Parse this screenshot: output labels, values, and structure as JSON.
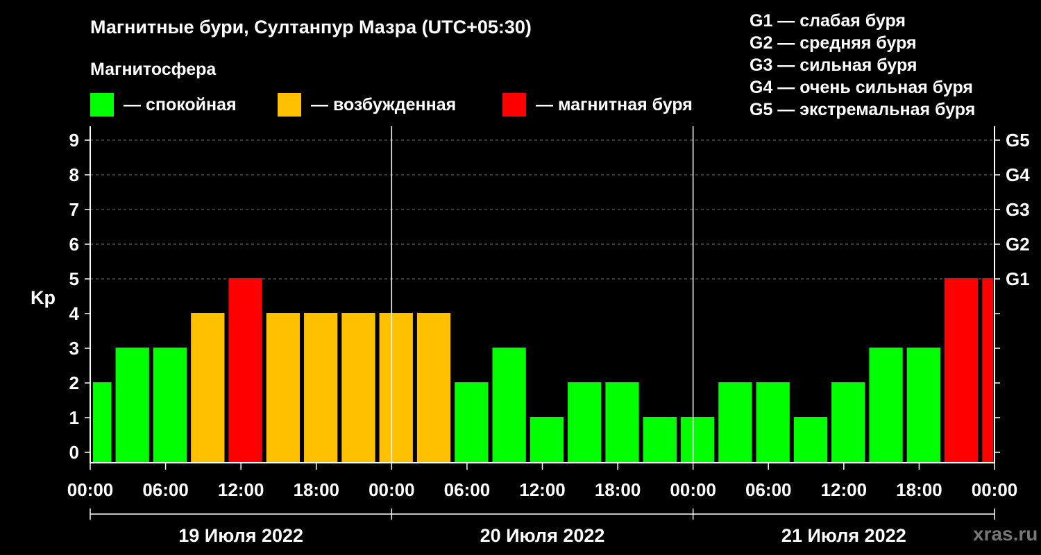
{
  "chart_data": {
    "type": "bar",
    "title": "Магнитные бури, Султанпур Мазра (UTC+05:30)",
    "subtitle": "Магнитосфера",
    "ylabel": "Kp",
    "ylim": [
      0,
      9
    ],
    "yticks": [
      "0",
      "1",
      "2",
      "3",
      "4",
      "5",
      "6",
      "7",
      "8",
      "9"
    ],
    "right_ticks": [
      {
        "value": 5,
        "label": "G1"
      },
      {
        "value": 6,
        "label": "G2"
      },
      {
        "value": 7,
        "label": "G3"
      },
      {
        "value": 8,
        "label": "G4"
      },
      {
        "value": 9,
        "label": "G5"
      }
    ],
    "x_range_hours": [
      0,
      72
    ],
    "x_ticks": [
      "00:00",
      "06:00",
      "12:00",
      "18:00",
      "00:00",
      "06:00",
      "12:00",
      "18:00",
      "00:00",
      "06:00",
      "12:00",
      "18:00",
      "00:00"
    ],
    "day_labels": [
      "19 Июля 2022",
      "20 Июля 2022",
      "21 Июля 2022"
    ],
    "legend": [
      {
        "label": "— спокойная",
        "color": "#00ff00"
      },
      {
        "label": "— возбужденная",
        "color": "#ffc000"
      },
      {
        "label": "— магнитная буря",
        "color": "#ff0000"
      }
    ],
    "g_legend": [
      "G1 — слабая буря",
      "G2 — средняя буря",
      "G3 — сильная буря",
      "G4 — очень сильная буря",
      "G5 — экстремальная буря"
    ],
    "bars": [
      {
        "start": 0,
        "end": 1.8,
        "value": 2,
        "level": "quiet"
      },
      {
        "start": 1.8,
        "end": 4.8,
        "value": 3,
        "level": "quiet"
      },
      {
        "start": 4.8,
        "end": 7.8,
        "value": 3,
        "level": "quiet"
      },
      {
        "start": 7.8,
        "end": 10.8,
        "value": 4,
        "level": "active"
      },
      {
        "start": 10.8,
        "end": 13.8,
        "value": 5,
        "level": "storm"
      },
      {
        "start": 13.8,
        "end": 16.8,
        "value": 4,
        "level": "active"
      },
      {
        "start": 16.8,
        "end": 19.8,
        "value": 4,
        "level": "active"
      },
      {
        "start": 19.8,
        "end": 22.8,
        "value": 4,
        "level": "active"
      },
      {
        "start": 22.8,
        "end": 25.8,
        "value": 4,
        "level": "active"
      },
      {
        "start": 25.8,
        "end": 28.8,
        "value": 4,
        "level": "active"
      },
      {
        "start": 28.8,
        "end": 31.8,
        "value": 2,
        "level": "quiet"
      },
      {
        "start": 31.8,
        "end": 34.8,
        "value": 3,
        "level": "quiet"
      },
      {
        "start": 34.8,
        "end": 37.8,
        "value": 1,
        "level": "quiet"
      },
      {
        "start": 37.8,
        "end": 40.8,
        "value": 2,
        "level": "quiet"
      },
      {
        "start": 40.8,
        "end": 43.8,
        "value": 2,
        "level": "quiet"
      },
      {
        "start": 43.8,
        "end": 46.8,
        "value": 1,
        "level": "quiet"
      },
      {
        "start": 46.8,
        "end": 49.8,
        "value": 1,
        "level": "quiet"
      },
      {
        "start": 49.8,
        "end": 52.8,
        "value": 2,
        "level": "quiet"
      },
      {
        "start": 52.8,
        "end": 55.8,
        "value": 2,
        "level": "quiet"
      },
      {
        "start": 55.8,
        "end": 58.8,
        "value": 1,
        "level": "quiet"
      },
      {
        "start": 58.8,
        "end": 61.8,
        "value": 2,
        "level": "quiet"
      },
      {
        "start": 61.8,
        "end": 64.8,
        "value": 3,
        "level": "quiet"
      },
      {
        "start": 64.8,
        "end": 67.8,
        "value": 3,
        "level": "quiet"
      },
      {
        "start": 67.8,
        "end": 70.8,
        "value": 5,
        "level": "storm"
      },
      {
        "start": 70.8,
        "end": 72,
        "value": 5,
        "level": "storm"
      }
    ],
    "colors": {
      "quiet": "#00ff00",
      "active": "#ffc000",
      "storm": "#ff0000"
    },
    "grid": "dashed horizontal"
  },
  "watermark": "xras.ru"
}
